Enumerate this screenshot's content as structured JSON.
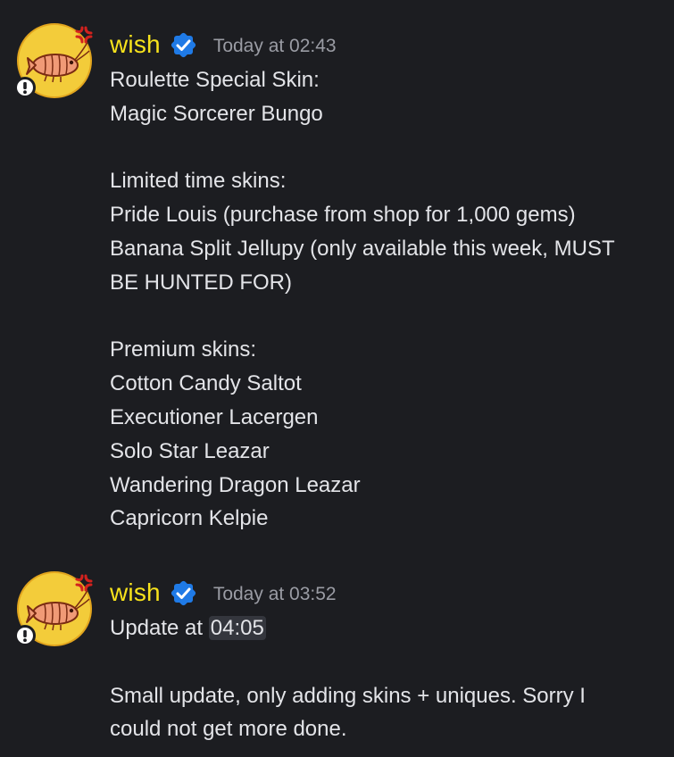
{
  "messages": [
    {
      "author": "wish",
      "timestamp": "Today at 02:43",
      "lines": [
        "Roulette Special Skin:",
        "Magic Sorcerer Bungo",
        "",
        "Limited time skins:",
        "Pride Louis (purchase from shop for 1,000 gems)",
        "Banana Split Jellupy (only available this week, MUST",
        "BE HUNTED FOR)",
        "",
        "Premium skins:",
        "Cotton Candy Saltot",
        "Executioner Lacergen",
        "Solo Star Leazar",
        "Wandering Dragon Leazar",
        "Capricorn Kelpie"
      ]
    },
    {
      "author": "wish",
      "timestamp": "Today at 03:52",
      "update_prefix": "Update at ",
      "update_time": "04:05",
      "lines": [
        "",
        "Small update, only adding skins + uniques. Sorry I",
        "could not get more done."
      ]
    }
  ],
  "colors": {
    "background": "#1c1d21",
    "username": "#f6e21c",
    "timestamp": "#9a9ca4",
    "text": "#e3e4e8",
    "verified_badge": "#1f7ae6"
  },
  "icons": {
    "avatar": "shrimp-avatar-icon",
    "verified": "verified-checkmark-icon",
    "status": "status-badge-icon"
  }
}
